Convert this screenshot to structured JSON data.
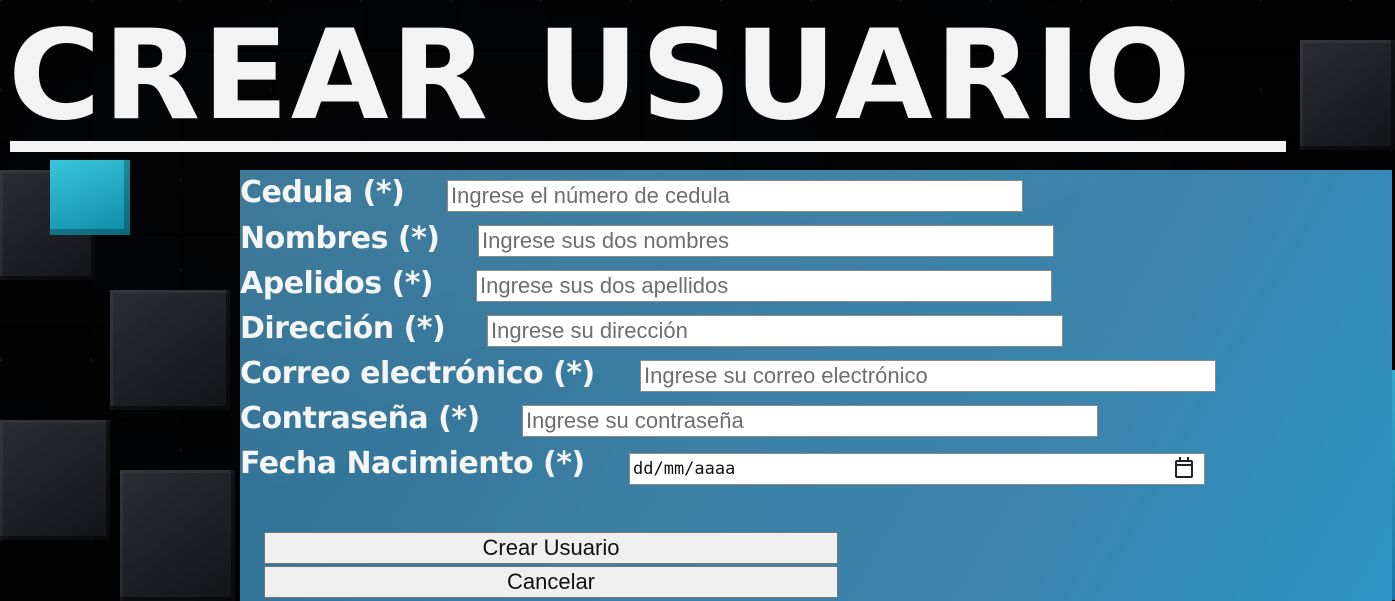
{
  "page": {
    "title": "CREAR USUARIO"
  },
  "form": {
    "fields": [
      {
        "label": "Cedula (*)",
        "placeholder": "Ingrese el número de cedula",
        "value": ""
      },
      {
        "label": "Nombres (*)",
        "placeholder": "Ingrese sus dos nombres",
        "value": ""
      },
      {
        "label": "Apelidos (*)",
        "placeholder": "Ingrese sus dos apellidos",
        "value": ""
      },
      {
        "label": "Dirección (*)",
        "placeholder": "Ingrese su dirección",
        "value": ""
      },
      {
        "label": "Correo electrónico (*)",
        "placeholder": "Ingrese su correo electrónico",
        "value": ""
      },
      {
        "label": "Contraseña (*)",
        "placeholder": "Ingrese su contraseña",
        "value": ""
      },
      {
        "label": "Fecha Nacimiento (*)",
        "placeholder": "dd/mm/aaaa",
        "value": ""
      }
    ],
    "date_icon": "calendar-icon",
    "buttons": {
      "submit_label": "Crear Usuario",
      "cancel_label": "Cancelar"
    }
  },
  "colors": {
    "panel": "#3a80a6",
    "title": "#f3f3f3",
    "accent_teal": "#39c6dc"
  }
}
